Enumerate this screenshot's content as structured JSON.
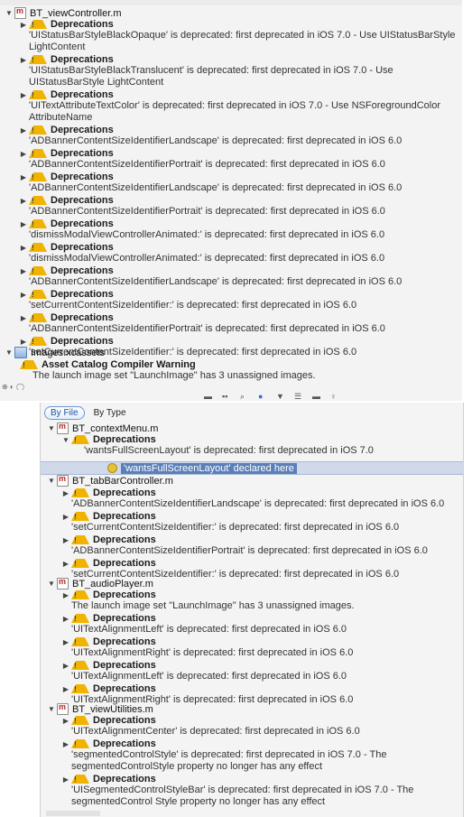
{
  "top": {
    "file1": "BT_viewController.m",
    "items": [
      {
        "label": "Deprecations",
        "msg": "'UIStatusBarStyleBlackOpaque' is deprecated: first deprecated in iOS 7.0 - Use UIStatusBarStyle LightContent"
      },
      {
        "label": "Deprecations",
        "msg": "'UIStatusBarStyleBlackTranslucent' is deprecated: first deprecated in iOS 7.0 - Use UIStatusBarStyle LightContent"
      },
      {
        "label": "Deprecations",
        "msg": "'UITextAttributeTextColor' is deprecated: first deprecated in iOS 7.0 - Use NSForegroundColor AttributeName"
      },
      {
        "label": "Deprecations",
        "msg": "'ADBannerContentSizeIdentifierLandscape' is deprecated: first deprecated in iOS 6.0"
      },
      {
        "label": "Deprecations",
        "msg": "'ADBannerContentSizeIdentifierPortrait' is deprecated: first deprecated in iOS 6.0"
      },
      {
        "label": "Deprecations",
        "msg": "'ADBannerContentSizeIdentifierLandscape' is deprecated: first deprecated in iOS 6.0"
      },
      {
        "label": "Deprecations",
        "msg": "'ADBannerContentSizeIdentifierPortrait' is deprecated: first deprecated in iOS 6.0"
      },
      {
        "label": "Deprecations",
        "msg": "'dismissModalViewControllerAnimated:' is deprecated: first deprecated in iOS 6.0"
      },
      {
        "label": "Deprecations",
        "msg": "'dismissModalViewControllerAnimated:' is deprecated: first deprecated in iOS 6.0"
      },
      {
        "label": "Deprecations",
        "msg": "'ADBannerContentSizeIdentifierLandscape' is deprecated: first deprecated in iOS 6.0"
      },
      {
        "label": "Deprecations",
        "msg": "'setCurrentContentSizeIdentifier:' is deprecated: first deprecated in iOS 6.0"
      },
      {
        "label": "Deprecations",
        "msg": "'ADBannerContentSizeIdentifierPortrait' is deprecated: first deprecated in iOS 6.0"
      },
      {
        "label": "Deprecations",
        "msg": "'setCurrentContentSizeIdentifier:' is deprecated: first deprecated in iOS 6.0"
      }
    ],
    "assets": "Images.xcassets",
    "asset_warning_title": "Asset Catalog Compiler Warning",
    "asset_warning_msg": "The launch image set \"LaunchImage\" has 3 unassigned images."
  },
  "bottom": {
    "mode_by_file": "By File",
    "mode_by_type": "By Type",
    "f1": "BT_contextMenu.m",
    "f1_label": "Deprecations",
    "f1_msg": "'wantsFullScreenLayout' is deprecated: first deprecated in iOS 7.0",
    "f1_note": "'wantsFullScreenLayout' declared here",
    "f2": "BT_tabBarController.m",
    "f2_items": [
      {
        "label": "Deprecations",
        "msg": "'ADBannerContentSizeIdentifierLandscape' is deprecated: first deprecated in iOS 6.0"
      },
      {
        "label": "Deprecations",
        "msg": "'setCurrentContentSizeIdentifier:' is deprecated: first deprecated in iOS 6.0"
      },
      {
        "label": "Deprecations",
        "msg": "'ADBannerContentSizeIdentifierPortrait' is deprecated: first deprecated in iOS 6.0"
      },
      {
        "label": "Deprecations",
        "msg": "'setCurrentContentSizeIdentifier:' is deprecated: first deprecated in iOS 6.0"
      }
    ],
    "f3": "BT_audioPlayer.m",
    "f3_items": [
      {
        "label": "Deprecations",
        "msg": "The launch image set \"LaunchImage\" has 3 unassigned images."
      },
      {
        "label": "Deprecations",
        "msg": "'UITextAlignmentLeft' is deprecated: first deprecated in iOS 6.0"
      },
      {
        "label": "Deprecations",
        "msg": "'UITextAlignmentRight' is deprecated: first deprecated in iOS 6.0"
      },
      {
        "label": "Deprecations",
        "msg": "'UITextAlignmentLeft' is deprecated: first deprecated in iOS 6.0"
      },
      {
        "label": "Deprecations",
        "msg": "'UITextAlignmentRight' is deprecated: first deprecated in iOS 6.0"
      }
    ],
    "f4": "BT_viewUtilities.m",
    "f4_items": [
      {
        "label": "Deprecations",
        "msg": "'UITextAlignmentCenter' is deprecated: first deprecated in iOS 6.0"
      },
      {
        "label": "Deprecations",
        "msg": "'segmentedControlStyle' is deprecated: first deprecated in iOS 7.0 - The segmentedControlStyle property no longer has any effect"
      },
      {
        "label": "Deprecations",
        "msg": "'UISegmentedControlStyleBar' is deprecated: first deprecated in iOS 7.0 - The segmentedControl Style property no longer has any effect"
      }
    ]
  }
}
